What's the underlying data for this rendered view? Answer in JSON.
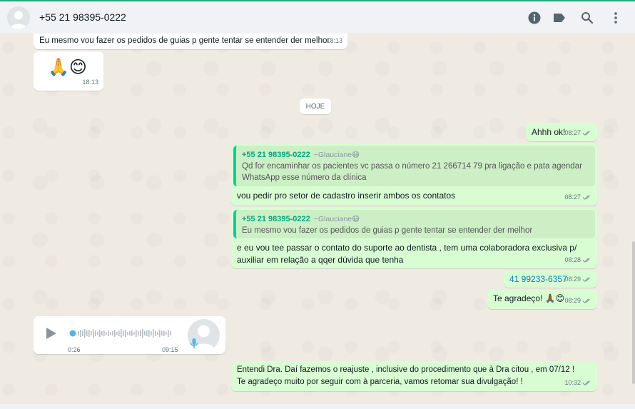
{
  "header": {
    "contact_name": "+55 21 98395-0222",
    "icons": [
      "info-icon",
      "label-icon",
      "search-icon",
      "menu-icon"
    ]
  },
  "date_separator": "HOJE",
  "messages": [
    {
      "type": "in",
      "text": "Eu mesmo vou fazer os pedidos de guias p gente tentar se entender der melhor",
      "time": "18:13"
    },
    {
      "type": "in",
      "emoji": "🙏😊",
      "time": "18:13"
    },
    {
      "type": "out",
      "text": "Ahhh ok!",
      "time": "08:27"
    },
    {
      "type": "out",
      "quote_author": "+55 21 98395-0222",
      "quote_alias": "~Glauciane😷",
      "quote_text": "Qd for encaminhar os pacientes  vc passa o número 21 266714 79 pra ligação e pata agendar WhatsApp esse número da clínica",
      "text": "vou pedir pro setor de cadastro inserir ambos os contatos",
      "time": "08:27"
    },
    {
      "type": "out",
      "quote_author": "+55 21 98395-0222",
      "quote_alias": "~Glauciane😷",
      "quote_text": "Eu mesmo vou fazer os pedidos de guias p gente tentar se entender der melhor",
      "text": "e eu vou tee passar o contato do suporte ao dentista , tem uma colaboradora exclusiva p/ auxiliar em relação a qqer dúvida que tenha",
      "time": "08:28"
    },
    {
      "type": "out",
      "text": "41 99233-6357",
      "time": "08:29"
    },
    {
      "type": "out",
      "text": "Te agradeço! 🙏🏾😊",
      "time": "08:29"
    },
    {
      "type": "in",
      "audio_elapsed": "0:26",
      "time": "09:15"
    },
    {
      "type": "out",
      "text": "Entendi Dra. Daí fazemos o reajuste , inclusive do procedimento que à Dra citou , em 07/12 ! Te agradeço muito  por seguir com à parceria, vamos retomar sua divulgação! !",
      "time": "10:32"
    }
  ],
  "colors": {
    "chat_bg": "#efeae2",
    "incoming": "#ffffff",
    "outgoing": "#d9fdd3",
    "accent": "#06cf9c",
    "read_ticks": "#53bdeb"
  }
}
